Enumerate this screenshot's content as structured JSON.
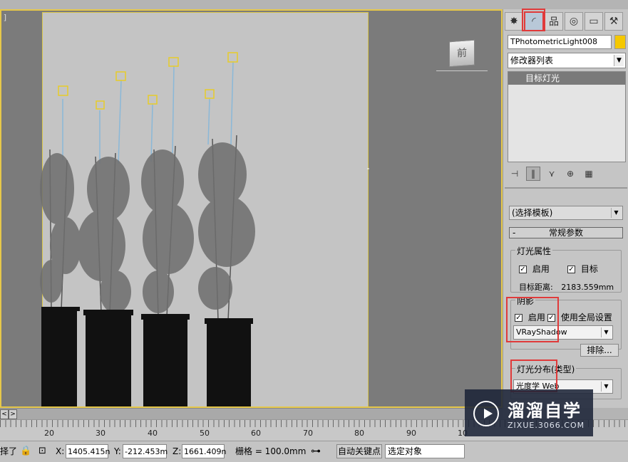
{
  "viewport": {
    "corner_label": "]",
    "viewcube_label": "前"
  },
  "panel": {
    "tabs": [
      {
        "name": "create-tab",
        "glyph": "✸"
      },
      {
        "name": "modify-tab",
        "glyph": "◜"
      },
      {
        "name": "hierarchy-tab",
        "glyph": "品"
      },
      {
        "name": "motion-tab",
        "glyph": "◎"
      },
      {
        "name": "display-tab",
        "glyph": "▭"
      },
      {
        "name": "utilities-tab",
        "glyph": "⚒"
      }
    ],
    "object_name": "TPhotometricLight008",
    "object_color": "#f5c800",
    "modifier_list": "修改器列表",
    "stack_items": [
      "目标灯光"
    ],
    "stack_tools": [
      "⊣",
      "‖",
      "⋎",
      "⊕",
      "▦"
    ],
    "template_select": "(选择模板)",
    "general_params_header": "常规参数",
    "general_params_collapse": "-",
    "light_props_title": "灯光属性",
    "light_on_label": "启用",
    "target_label": "目标",
    "target_distance_label": "目标距离:",
    "target_distance_value": "2183.559mm",
    "shadow_title": "阴影",
    "shadow_on_label": "启用",
    "use_global_label": "使用全局设置",
    "shadow_type": "VRayShadow",
    "exclude_button": "排除...",
    "distribution_title": "灯光分布(类型)",
    "distribution_type": "光度学 Web",
    "check_mark": "✓",
    "highlight_color": "#e03a3a"
  },
  "timeline": {
    "slider_prev": "<",
    "slider_next": ">",
    "ticks": [
      "20",
      "30",
      "40",
      "50",
      "60",
      "70",
      "80",
      "90",
      "10"
    ]
  },
  "statusbar": {
    "left_text": "择了",
    "x_label": "X:",
    "x_value": "1405.415n",
    "y_label": "Y:",
    "y_value": "-212.453m",
    "z_label": "Z:",
    "z_value": "1661.409n",
    "grid_label": "栅格 = 100.0mm",
    "auto_key": "自动关键点",
    "selection_filter": "选定对象"
  },
  "watermark": {
    "title": "溜溜自学",
    "url": "ZIXUE.3066.COM"
  }
}
